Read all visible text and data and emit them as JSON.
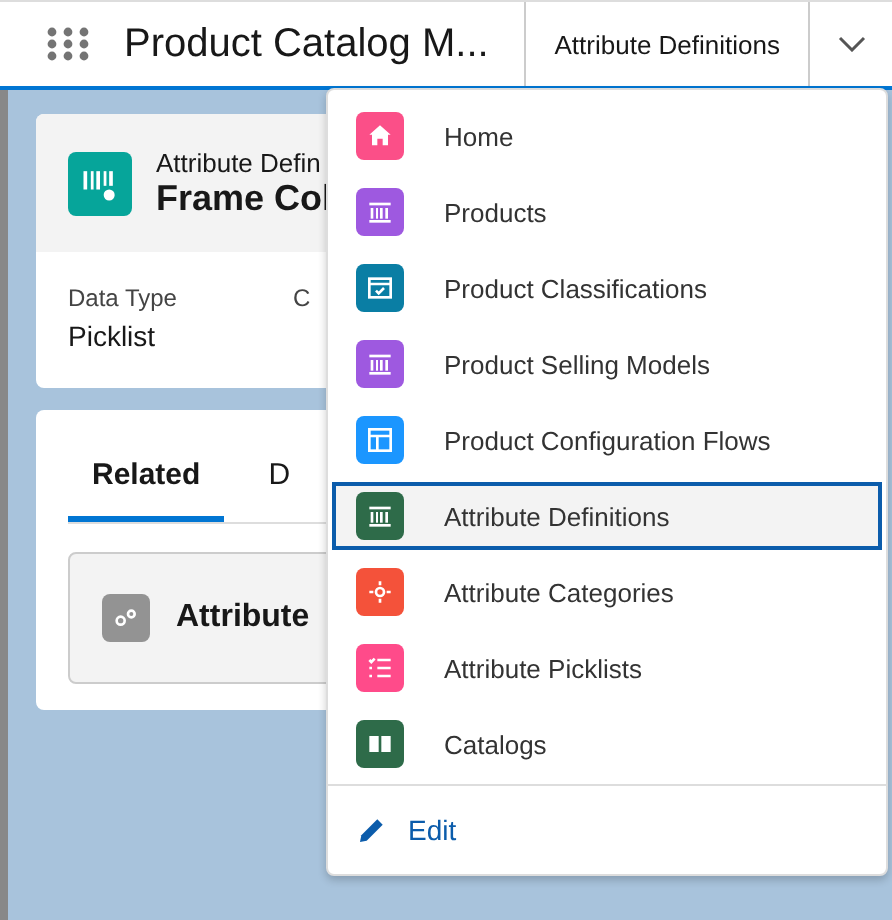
{
  "top_bar": {
    "app_name": "Product Catalog M...",
    "tab_label": "Attribute Definitions"
  },
  "record": {
    "object_label": "Attribute Defin",
    "title": "Frame Col",
    "fields": [
      {
        "label": "Data Type",
        "value": "Picklist"
      },
      {
        "label": "C"
      }
    ]
  },
  "tabs": [
    {
      "label": "Related",
      "selected": true
    },
    {
      "label": "D",
      "selected": false
    }
  ],
  "related_card": {
    "title": "Attribute"
  },
  "nav_menu": {
    "items": [
      {
        "label": "Home",
        "color": "#fb4f88",
        "selected": false
      },
      {
        "label": "Products",
        "color": "#9e59e0",
        "selected": false
      },
      {
        "label": "Product Classifications",
        "color": "#0a7ea4",
        "selected": false
      },
      {
        "label": "Product Selling Models",
        "color": "#9e59e0",
        "selected": false
      },
      {
        "label": "Product Configuration Flows",
        "color": "#1b96ff",
        "selected": false
      },
      {
        "label": "Attribute Definitions",
        "color": "#2e6b49",
        "selected": true
      },
      {
        "label": "Attribute Categories",
        "color": "#f4523a",
        "selected": false
      },
      {
        "label": "Attribute Picklists",
        "color": "#ff4b8a",
        "selected": false
      },
      {
        "label": "Catalogs",
        "color": "#2e6b49",
        "selected": false
      }
    ],
    "edit": "Edit"
  }
}
